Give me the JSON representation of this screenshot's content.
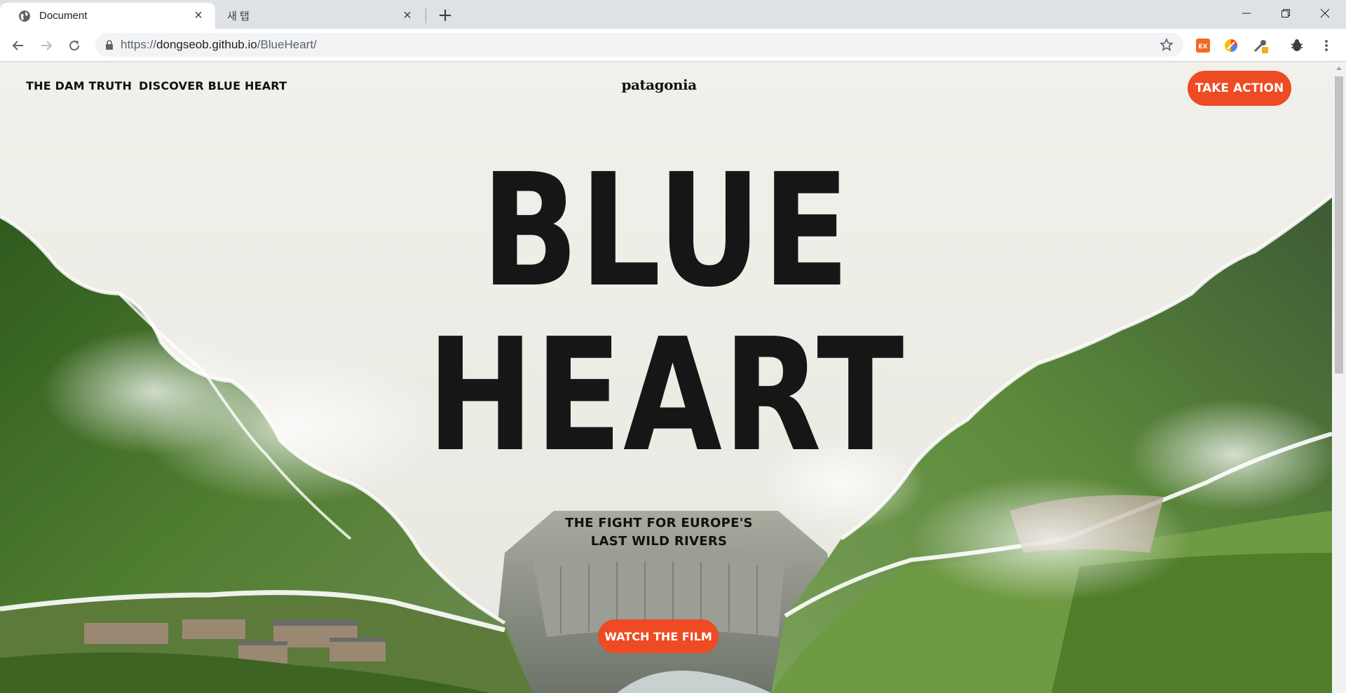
{
  "browser": {
    "tabs": [
      {
        "title": "Document",
        "active": true
      },
      {
        "title": "새 탭",
        "active": false
      }
    ],
    "new_tab_symbol": "+",
    "url_scheme": "https://",
    "url_host": "dongseob.github.io",
    "url_path": "/BlueHeart/",
    "icons": [
      "globe-icon",
      "back-icon",
      "forward-icon",
      "reload-icon",
      "lock-icon",
      "bookmark-star-icon",
      "extension-ex-icon",
      "extension-color-icon",
      "extension-eyedropper-icon",
      "extension-bug-icon",
      "menu-icon",
      "minimize-icon",
      "restore-icon",
      "close-window-icon"
    ],
    "extension_ex_label": "EX"
  },
  "site": {
    "nav": {
      "link1": "THE DAM TRUTH",
      "link2": "DISCOVER BLUE HEART"
    },
    "logo": "patagonia",
    "cta_top": "TAKE ACTION",
    "hero": {
      "line1": "BLUE",
      "line2": "HEART"
    },
    "tagline_line1": "THE FIGHT FOR EUROPE'S",
    "tagline_line2": "LAST WILD RIVERS",
    "cta_bottom": "WATCH THE FILM",
    "colors": {
      "accent": "#ee4a23",
      "background": "#f1f0ea",
      "ink": "#161616",
      "forest": "#3f6a2a"
    }
  }
}
